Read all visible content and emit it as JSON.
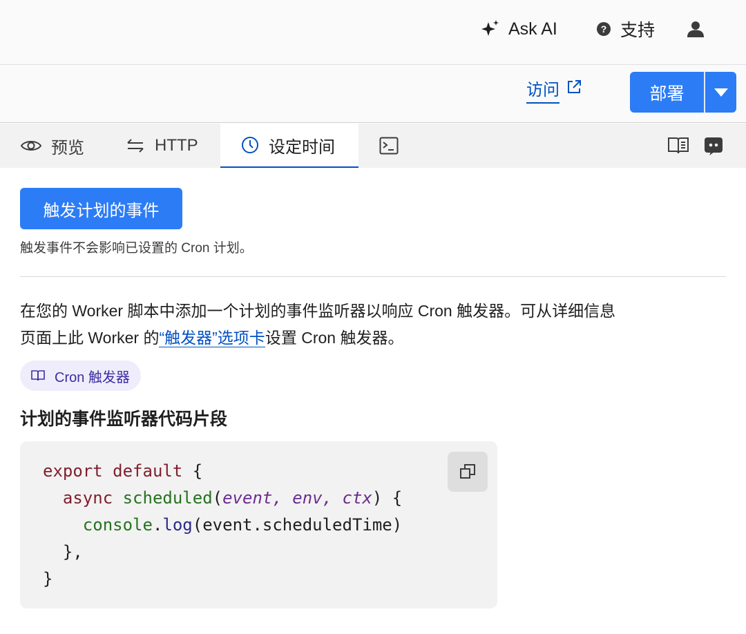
{
  "header": {
    "ask_ai_label": "Ask AI",
    "support_label": "支持"
  },
  "actions": {
    "visit_label": "访问",
    "deploy_label": "部署"
  },
  "tabs": [
    {
      "label": "预览",
      "icon": "eye-icon"
    },
    {
      "label": "HTTP",
      "icon": "swap-arrows-icon"
    },
    {
      "label": "设定时间",
      "icon": "clock-icon",
      "active": true
    },
    {
      "label": "",
      "icon": "terminal-icon"
    }
  ],
  "schedule": {
    "trigger_button_label": "触发计划的事件",
    "trigger_note": "触发事件不会影响已设置的 Cron 计划。",
    "description_part1": "在您的 Worker 脚本中添加一个计划的事件监听器以响应 Cron 触发器。可从详细信息页面上此 Worker 的",
    "description_link": "“触发器”选项卡",
    "description_part2": "设置 Cron 触发器。",
    "cron_badge_label": "Cron 触发器",
    "snippet_title": "计划的事件监听器代码片段",
    "code": {
      "line1_kw": "export default",
      "line1_rest": " {",
      "line2_kw": "async",
      "line2_fn": "scheduled",
      "line2_p1": "event",
      "line2_p2": "env",
      "line2_p3": "ctx",
      "line3_obj": "console",
      "line3_fn": "log",
      "line3_arg": "(event.scheduledTime)",
      "line4": "},",
      "line5": "}"
    }
  },
  "colors": {
    "primary_button": "#2c7cf6",
    "link": "#0051c3",
    "badge_bg": "#efedfb"
  }
}
